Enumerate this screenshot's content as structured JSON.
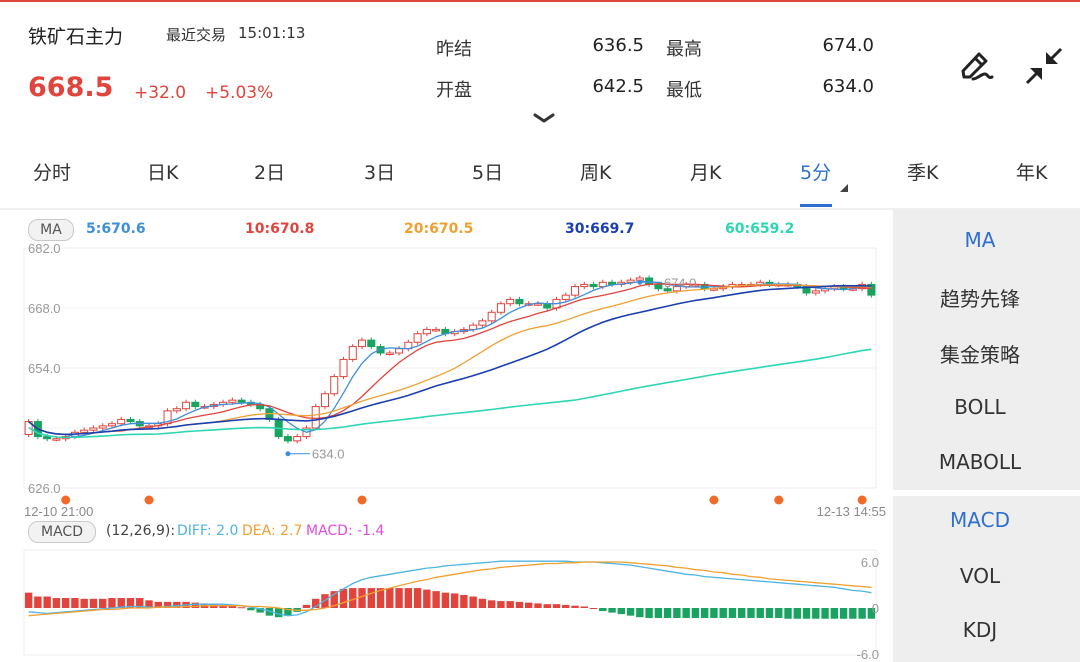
{
  "header": {
    "name": "铁矿石主力",
    "trade_label": "最近交易",
    "trade_time": "15:01:13",
    "price": "668.5",
    "change": "+32.0",
    "change_pct": "+5.03%",
    "stats": [
      {
        "label": "昨结",
        "value": "636.5"
      },
      {
        "label": "最高",
        "value": "674.0"
      },
      {
        "label": "开盘",
        "value": "642.5"
      },
      {
        "label": "最低",
        "value": "634.0"
      }
    ],
    "icons": [
      "pen-icon",
      "shrink-icon",
      "chevron-down-icon"
    ]
  },
  "tabs": [
    "分时",
    "日K",
    "2日",
    "3日",
    "5日",
    "周K",
    "月K",
    "5分",
    "季K",
    "年K"
  ],
  "active_tab": "5分",
  "colors": {
    "up": "#e0443c",
    "down": "#1aa260",
    "accent": "#2f6fd0",
    "ma5": "#3d8fdc",
    "ma10": "#e0443c",
    "ma20": "#f0a030",
    "ma30": "#1a3fb0",
    "ma60": "#2dd6b4",
    "macd": "#e24ddc",
    "marker": "#f26a2a"
  },
  "ma_legend": {
    "badge": "MA",
    "items": [
      "5:670.6",
      "10:670.8",
      "20:670.5",
      "30:669.7",
      "60:659.2"
    ]
  },
  "macd_legend": {
    "badge": "MACD",
    "params": "(12,26,9):",
    "diff": "DIFF: 2.0",
    "dea": "DEA: 2.7",
    "macd": "MACD: -1.4"
  },
  "side_panel": {
    "main_indicators": [
      "MA",
      "趋势先锋",
      "集金策略",
      "BOLL",
      "MABOLL"
    ],
    "sub_indicators": [
      "MACD",
      "VOL",
      "KDJ"
    ],
    "active_main": "MA",
    "active_sub": "MACD"
  },
  "chart_data": [
    {
      "type": "candlestick",
      "y_ticks": [
        "682.0",
        "668.0",
        "654.0",
        "626.0"
      ],
      "ylim": [
        626,
        682
      ],
      "x_labels": [
        "12-10 21:00",
        "12-13 14:55"
      ],
      "annotations": [
        {
          "label": "674.0",
          "kind": "high",
          "value": 674.0
        },
        {
          "label": "634.0",
          "kind": "low",
          "value": 634.0
        }
      ],
      "close": [
        641.5,
        638.0,
        637.5,
        637.5,
        638.0,
        639.0,
        639.5,
        640.0,
        640.5,
        641.0,
        642.0,
        641.5,
        640.5,
        640.5,
        641.0,
        644.0,
        644.5,
        646.0,
        645.0,
        645.0,
        645.5,
        646.0,
        646.5,
        646.0,
        645.5,
        644.5,
        642.0,
        638.0,
        637.0,
        638.0,
        640.0,
        645.0,
        648.0,
        652.0,
        656.0,
        659.0,
        660.5,
        659.0,
        657.5,
        657.5,
        658.5,
        660.0,
        662.0,
        663.0,
        663.0,
        662.0,
        662.5,
        663.0,
        664.0,
        665.0,
        667.0,
        669.0,
        670.0,
        669.0,
        669.0,
        669.0,
        668.0,
        670.0,
        671.0,
        673.0,
        673.5,
        673.0,
        674.0,
        673.5,
        674.0,
        674.5,
        675.0,
        673.5,
        672.5,
        672.0,
        673.0,
        673.5,
        673.5,
        672.5,
        672.5,
        673.0,
        673.5,
        673.5,
        673.5,
        674.0,
        673.5,
        673.5,
        673.5,
        673.0,
        671.5,
        672.0,
        672.5,
        673.0,
        672.5,
        672.5,
        673.5,
        671.0
      ],
      "macd": {
        "ticks": [
          "6.0",
          "0",
          "-6.0"
        ],
        "hist": [
          2.0,
          1.5,
          1.5,
          1.3,
          1.3,
          1.3,
          1.2,
          1.2,
          1.2,
          1.3,
          1.3,
          1.3,
          1.3,
          1.0,
          0.8,
          0.8,
          0.8,
          0.8,
          0.7,
          0.6,
          0.5,
          0.4,
          0.3,
          0.1,
          -0.3,
          -0.6,
          -1.0,
          -1.2,
          -1.0,
          -0.5,
          0.4,
          1.2,
          1.8,
          2.2,
          2.5,
          2.6,
          2.6,
          2.6,
          2.6,
          2.6,
          2.6,
          2.6,
          2.6,
          2.4,
          2.2,
          2.0,
          1.9,
          1.7,
          1.5,
          1.2,
          1.0,
          0.9,
          0.9,
          0.8,
          0.7,
          0.6,
          0.5,
          0.5,
          0.4,
          0.3,
          0.2,
          0.0,
          -0.4,
          -0.6,
          -0.8,
          -1.0,
          -1.2,
          -1.3,
          -1.3,
          -1.3,
          -1.3,
          -1.3,
          -1.3,
          -1.3,
          -1.3,
          -1.3,
          -1.3,
          -1.3,
          -1.3,
          -1.3,
          -1.3,
          -1.3,
          -1.4,
          -1.4,
          -1.4,
          -1.4,
          -1.4,
          -1.4,
          -1.4,
          -1.4,
          -1.4,
          -1.4
        ],
        "diff": [
          -0.5,
          -0.6,
          -0.7,
          -0.6,
          -0.5,
          -0.4,
          -0.3,
          -0.2,
          -0.1,
          0.0,
          0.1,
          0.2,
          0.2,
          0.1,
          0.1,
          0.2,
          0.3,
          0.4,
          0.5,
          0.5,
          0.5,
          0.5,
          0.4,
          0.3,
          0.1,
          -0.1,
          -0.4,
          -0.8,
          -1.0,
          -0.9,
          -0.5,
          0.2,
          1.0,
          1.8,
          2.5,
          3.2,
          3.7,
          4.0,
          4.2,
          4.4,
          4.6,
          4.8,
          5.0,
          5.2,
          5.3,
          5.5,
          5.6,
          5.7,
          5.8,
          5.9,
          6.0,
          6.1,
          6.1,
          6.1,
          6.1,
          6.1,
          6.1,
          6.1,
          6.1,
          6.0,
          6.0,
          6.0,
          5.9,
          5.8,
          5.7,
          5.6,
          5.4,
          5.2,
          5.0,
          4.8,
          4.6,
          4.4,
          4.3,
          4.1,
          4.0,
          3.9,
          3.8,
          3.7,
          3.6,
          3.5,
          3.4,
          3.3,
          3.2,
          3.1,
          3.0,
          2.9,
          2.8,
          2.7,
          2.5,
          2.3,
          2.2,
          2.0
        ],
        "dea": [
          -1.0,
          -0.9,
          -0.8,
          -0.7,
          -0.6,
          -0.5,
          -0.4,
          -0.3,
          -0.2,
          -0.2,
          -0.1,
          0.0,
          0.0,
          0.0,
          0.1,
          0.1,
          0.1,
          0.2,
          0.2,
          0.3,
          0.3,
          0.3,
          0.3,
          0.3,
          0.2,
          0.2,
          0.1,
          0.0,
          -0.2,
          -0.3,
          -0.3,
          -0.2,
          0.0,
          0.3,
          0.7,
          1.1,
          1.5,
          1.9,
          2.3,
          2.6,
          2.9,
          3.2,
          3.5,
          3.7,
          4.0,
          4.2,
          4.4,
          4.6,
          4.8,
          5.0,
          5.1,
          5.3,
          5.4,
          5.5,
          5.6,
          5.7,
          5.8,
          5.8,
          5.9,
          5.9,
          6.0,
          6.0,
          6.0,
          6.0,
          6.0,
          5.9,
          5.8,
          5.7,
          5.6,
          5.5,
          5.3,
          5.2,
          5.0,
          4.9,
          4.7,
          4.6,
          4.4,
          4.3,
          4.1,
          4.0,
          3.8,
          3.7,
          3.6,
          3.5,
          3.4,
          3.3,
          3.2,
          3.1,
          3.0,
          2.9,
          2.8,
          2.7
        ]
      }
    }
  ]
}
